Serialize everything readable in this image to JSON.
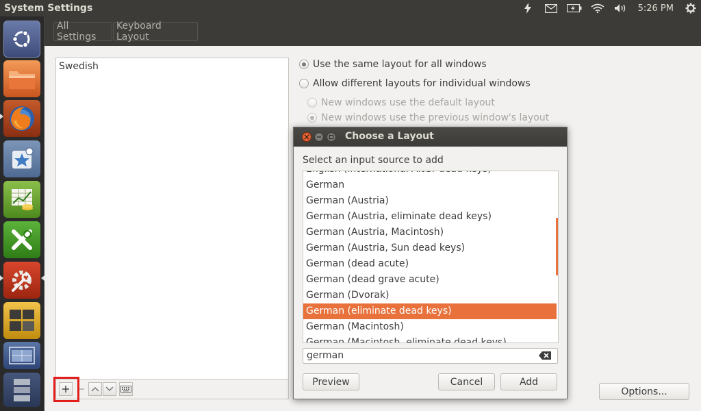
{
  "topbar": {
    "app_title": "System Settings",
    "clock": "5:26 PM",
    "indicators": [
      "bolt-icon",
      "mail-icon",
      "battery-icon",
      "wifi-icon",
      "volume-icon",
      "gear-icon"
    ]
  },
  "launcher": {
    "items": [
      "ubuntu-dash",
      "files",
      "firefox",
      "software-center",
      "spreadsheet",
      "text-editor",
      "system-settings",
      "workspaces",
      "workspace-switcher",
      "trash"
    ]
  },
  "breadcrumb": {
    "all_settings": "All Settings",
    "current": "Keyboard Layout"
  },
  "layouts": {
    "items": [
      "Swedish"
    ]
  },
  "options": {
    "same_layout": "Use the same layout for all windows",
    "different_layouts": "Allow different layouts for individual windows",
    "default_layout": "New windows use the default layout",
    "previous_layout": "New windows use the previous window's layout",
    "options_button": "Options..."
  },
  "dialog": {
    "title": "Choose a Layout",
    "prompt": "Select an input source to add",
    "rows": [
      "English (international AltGr dead keys)",
      "German",
      "German (Austria)",
      "German (Austria, eliminate dead keys)",
      "German (Austria, Macintosh)",
      "German (Austria, Sun dead keys)",
      "German (dead acute)",
      "German (dead grave acute)",
      "German (Dvorak)",
      "German (eliminate dead keys)",
      "German (Macintosh)",
      "German (Macintosh, eliminate dead keys)"
    ],
    "selected_row": "German (eliminate dead keys)",
    "search_value": "german",
    "preview_label": "Preview",
    "cancel_label": "Cancel",
    "add_label": "Add"
  },
  "colors": {
    "accent": "#e8713c",
    "panel": "#3c3b37",
    "launcher": "#2b2a2a",
    "highlight_box": "#e31c1c"
  }
}
